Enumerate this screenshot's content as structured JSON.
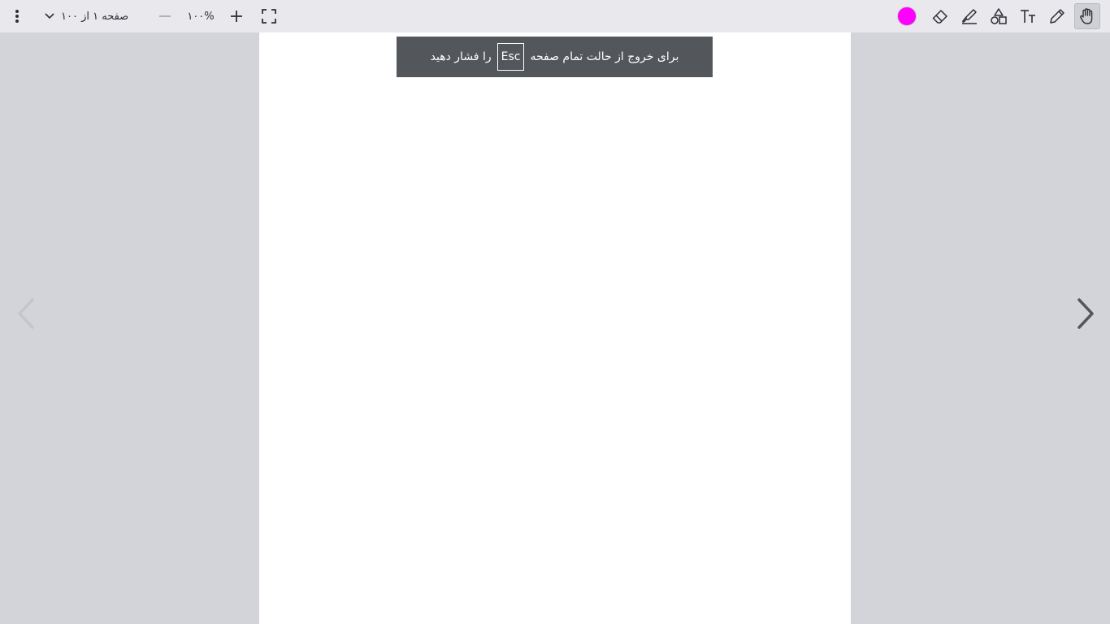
{
  "toolbar": {
    "page_indicator": "صفحه ۱ از ۱۰۰",
    "zoom_level": "۱۰۰%",
    "icons": {
      "menu": "more-vertical-icon",
      "page_dropdown": "chevron-down-icon",
      "zoom_out": "minus-icon",
      "zoom_in": "plus-icon",
      "fullscreen": "fullscreen-icon",
      "eraser": "eraser-icon",
      "highlighter": "highlighter-icon",
      "shapes": "shapes-icon",
      "text": "text-size-icon",
      "pen": "pencil-icon",
      "hand": "hand-icon"
    },
    "active_tool": "hand",
    "current_color": "#ff00ff"
  },
  "toast": {
    "text_before": "برای خروج از حالت تمام صفحه",
    "key": "Esc",
    "text_after": "را فشار دهید"
  },
  "navigation": {
    "prev_icon": "chevron-left-icon",
    "next_icon": "chevron-right-icon",
    "prev_enabled": false,
    "next_enabled": true
  },
  "colors": {
    "toolbar_bg": "#e8e8ed",
    "viewer_bg": "#d3d4d9",
    "page_bg": "#ffffff",
    "toast_bg": "#53565b"
  }
}
